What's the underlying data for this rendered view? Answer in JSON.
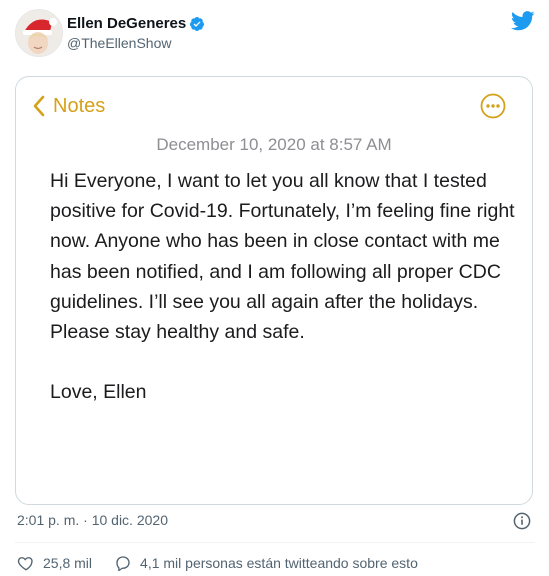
{
  "tweet": {
    "display_name": "Ellen DeGeneres",
    "handle": "@TheEllenShow",
    "timestamp": "2:01 p. m. · 10 dic. 2020",
    "likes": "25,8 mil",
    "conversation": "4,1 mil personas están twitteando sobre esto"
  },
  "note": {
    "back_label": "Notes",
    "date": "December 10, 2020 at 8:57 AM",
    "paragraph": "Hi Everyone, I want to let you all know that I tested positive for Covid-19. Fortunately, I’m feeling fine right now. Anyone who has been in close contact with me has been notified, and I am following all proper CDC guidelines. I’ll see you all again after the holidays. Please stay healthy and safe.",
    "signoff": "Love, Ellen"
  },
  "colors": {
    "notes_accent": "#d6a11a",
    "twitter_blue": "#1d9bf0",
    "muted_text": "#536471"
  },
  "icons": [
    "verified-badge-icon",
    "twitter-bird-icon",
    "chevron-left-icon",
    "more-options-icon",
    "info-icon",
    "heart-icon",
    "speech-bubble-icon"
  ]
}
